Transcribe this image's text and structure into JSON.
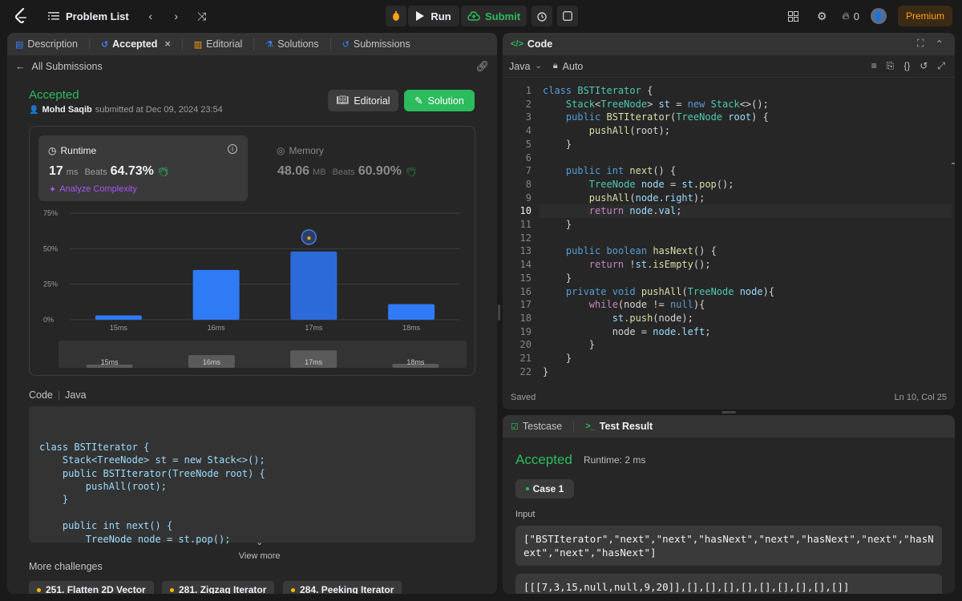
{
  "topbar": {
    "title": "Problem List",
    "run_label": "Run",
    "submit_label": "Submit",
    "streak_count": "0",
    "premium_label": "Premium"
  },
  "left": {
    "tabs": [
      {
        "label": "Description"
      },
      {
        "label": "Accepted"
      },
      {
        "label": "Editorial"
      },
      {
        "label": "Solutions"
      },
      {
        "label": "Submissions"
      }
    ],
    "back_label": "All Submissions",
    "status": "Accepted",
    "author_name": "Mohd Saqib",
    "submitted_text": "submitted at Dec 09, 2024 23:54",
    "editorial_btn": "Editorial",
    "solution_btn": "Solution",
    "runtime": {
      "title": "Runtime",
      "value": "17",
      "unit": "ms",
      "beats_label": "Beats",
      "beats_value": "64.73%",
      "analyze_label": "Analyze Complexity"
    },
    "memory": {
      "title": "Memory",
      "value": "48.06",
      "unit": "MB",
      "beats_label": "Beats",
      "beats_value": "60.90%"
    },
    "code_label": "Code",
    "code_lang": "Java",
    "code_preview": [
      "class BSTIterator {",
      "    Stack<TreeNode> st = new Stack<>();",
      "    public BSTIterator(TreeNode root) {",
      "        pushAll(root);",
      "    }",
      "",
      "    public int next() {",
      "        TreeNode node = st.pop();"
    ],
    "view_more": "View more",
    "more_challenges": "More challenges",
    "challenges": [
      {
        "label": "251. Flatten 2D Vector"
      },
      {
        "label": "281. Zigzag Iterator"
      },
      {
        "label": "284. Peeking Iterator"
      }
    ]
  },
  "chart_data": {
    "type": "bar",
    "categories": [
      "15ms",
      "16ms",
      "17ms",
      "18ms"
    ],
    "values": [
      3,
      35,
      48,
      11
    ],
    "ylim": [
      0,
      75
    ],
    "yticks": [
      "0%",
      "25%",
      "50%",
      "75%"
    ],
    "highlight_category": "17ms",
    "bar_color": "#2f7af5",
    "minimap_values": [
      3,
      35,
      48,
      11
    ],
    "grid": true
  },
  "right": {
    "code_title": "Code",
    "lang": "Java",
    "mode": "Auto",
    "saved_label": "Saved",
    "cursor_pos": "Ln 10, Col 25",
    "current_line": "10",
    "line_numbers": [
      "1",
      "2",
      "3",
      "4",
      "5",
      "6",
      "7",
      "8",
      "9",
      "10",
      "11",
      "12",
      "13",
      "14",
      "15",
      "16",
      "17",
      "18",
      "19",
      "20",
      "21",
      "22"
    ],
    "testcase_tab": "Testcase",
    "test_result_tab": "Test Result",
    "result_status": "Accepted",
    "result_runtime": "Runtime: 2 ms",
    "case_label": "Case 1",
    "input_label": "Input",
    "input_1": "[\"BSTIterator\",\"next\",\"next\",\"hasNext\",\"next\",\"hasNext\",\"next\",\"hasNext\",\"next\",\"hasNext\"]",
    "input_2": "[[[7,3,15,null,null,9,20]],[],[],[],[],[],[],[],[],[]]"
  },
  "colors": {
    "accent_green": "#2cbb5d",
    "premium": "#ffa116",
    "bar_blue": "#2f7af5"
  }
}
